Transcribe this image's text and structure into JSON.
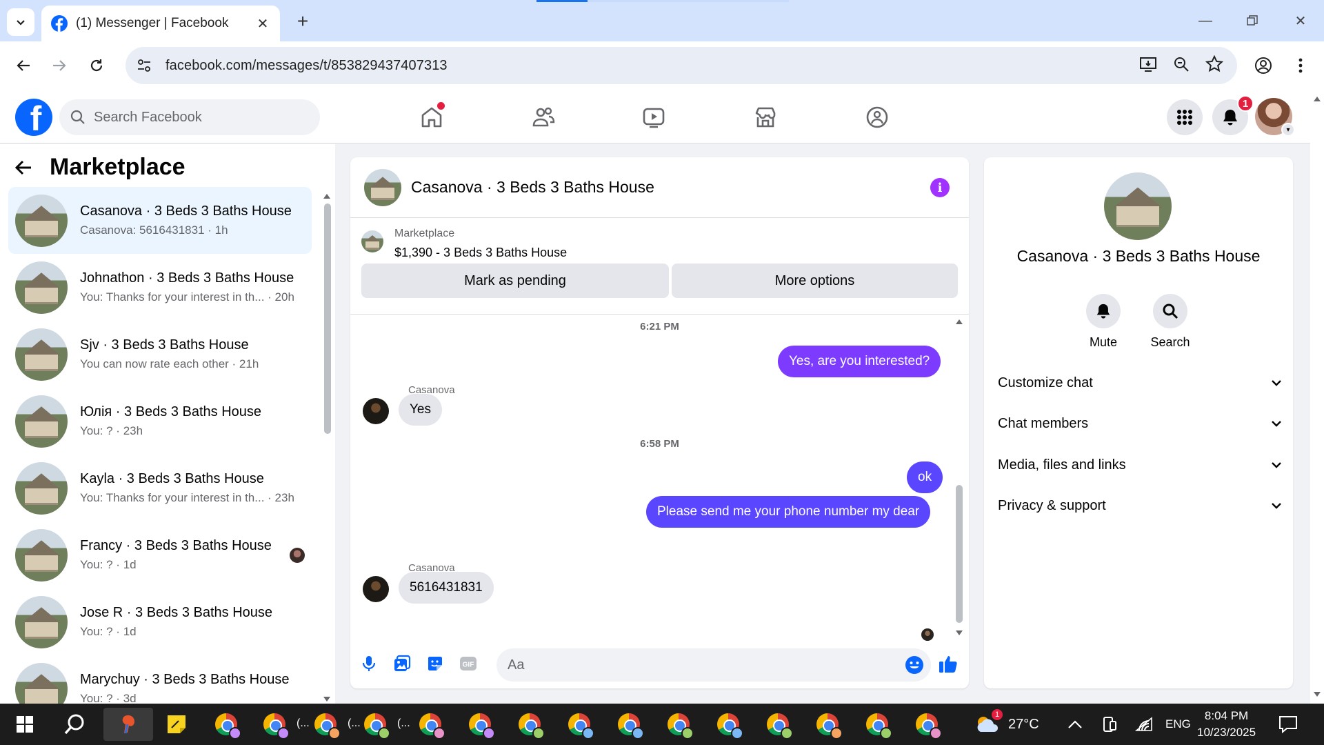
{
  "browser": {
    "tab_title": "(1) Messenger | Facebook",
    "url": "facebook.com/messages/t/853829437407313"
  },
  "facebook": {
    "logo_letter": "f",
    "search_placeholder": "Search Facebook",
    "notification_count": "1"
  },
  "sidebar": {
    "title": "Marketplace",
    "conversations": [
      {
        "name": "Casanova · 3 Beds 3 Baths House",
        "preview": "Casanova: 5616431831 · 1h",
        "active": true
      },
      {
        "name": "Johnathon · 3 Beds 3 Baths House",
        "preview": "You: Thanks for your interest in th... · 20h"
      },
      {
        "name": "Sjv · 3 Beds 3 Baths House",
        "preview": "You can now rate each other · 21h"
      },
      {
        "name": "Юлія · 3 Beds 3 Baths House",
        "preview": "You: ? · 23h"
      },
      {
        "name": "Kayla · 3 Beds 3 Baths House",
        "preview": "You: Thanks for your interest in th... · 23h"
      },
      {
        "name": "Francy · 3 Beds 3 Baths House",
        "preview": "You: ? · 1d"
      },
      {
        "name": "Jose R · 3 Beds 3 Baths House",
        "preview": "You: ? · 1d"
      },
      {
        "name": "Marychuy · 3 Beds 3 Baths House",
        "preview": "You: ? · 3d"
      }
    ]
  },
  "chat": {
    "title": "Casanova · 3 Beds 3 Baths House",
    "marketplace_label": "Marketplace",
    "listing": "$1,390 - 3 Beds 3 Baths House",
    "mark_pending": "Mark as pending",
    "more_options": "More options",
    "time1": "6:21 PM",
    "msg1": "Yes, are you interested?",
    "sender1": "Casanova",
    "msg2": "Yes",
    "time2": "6:58 PM",
    "msg3": "ok",
    "msg4": "Please send me your phone number my dear",
    "sender2": "Casanova",
    "msg5": "5616431831",
    "composer_placeholder": "Aa"
  },
  "info_panel": {
    "name": "Casanova · 3 Beds 3 Baths House",
    "mute_label": "Mute",
    "search_label": "Search",
    "sections": [
      "Customize chat",
      "Chat members",
      "Media, files and links",
      "Privacy & support"
    ]
  },
  "taskbar": {
    "temperature": "27°C",
    "language": "ENG",
    "time": "8:04 PM",
    "date": "10/23/2025",
    "weather_badge": "1"
  },
  "colors": {
    "fb_blue": "#0866ff",
    "purple_bubble": "#7d3bff",
    "blue_bubble": "#5b46ff",
    "info_purple": "#a033ff"
  }
}
